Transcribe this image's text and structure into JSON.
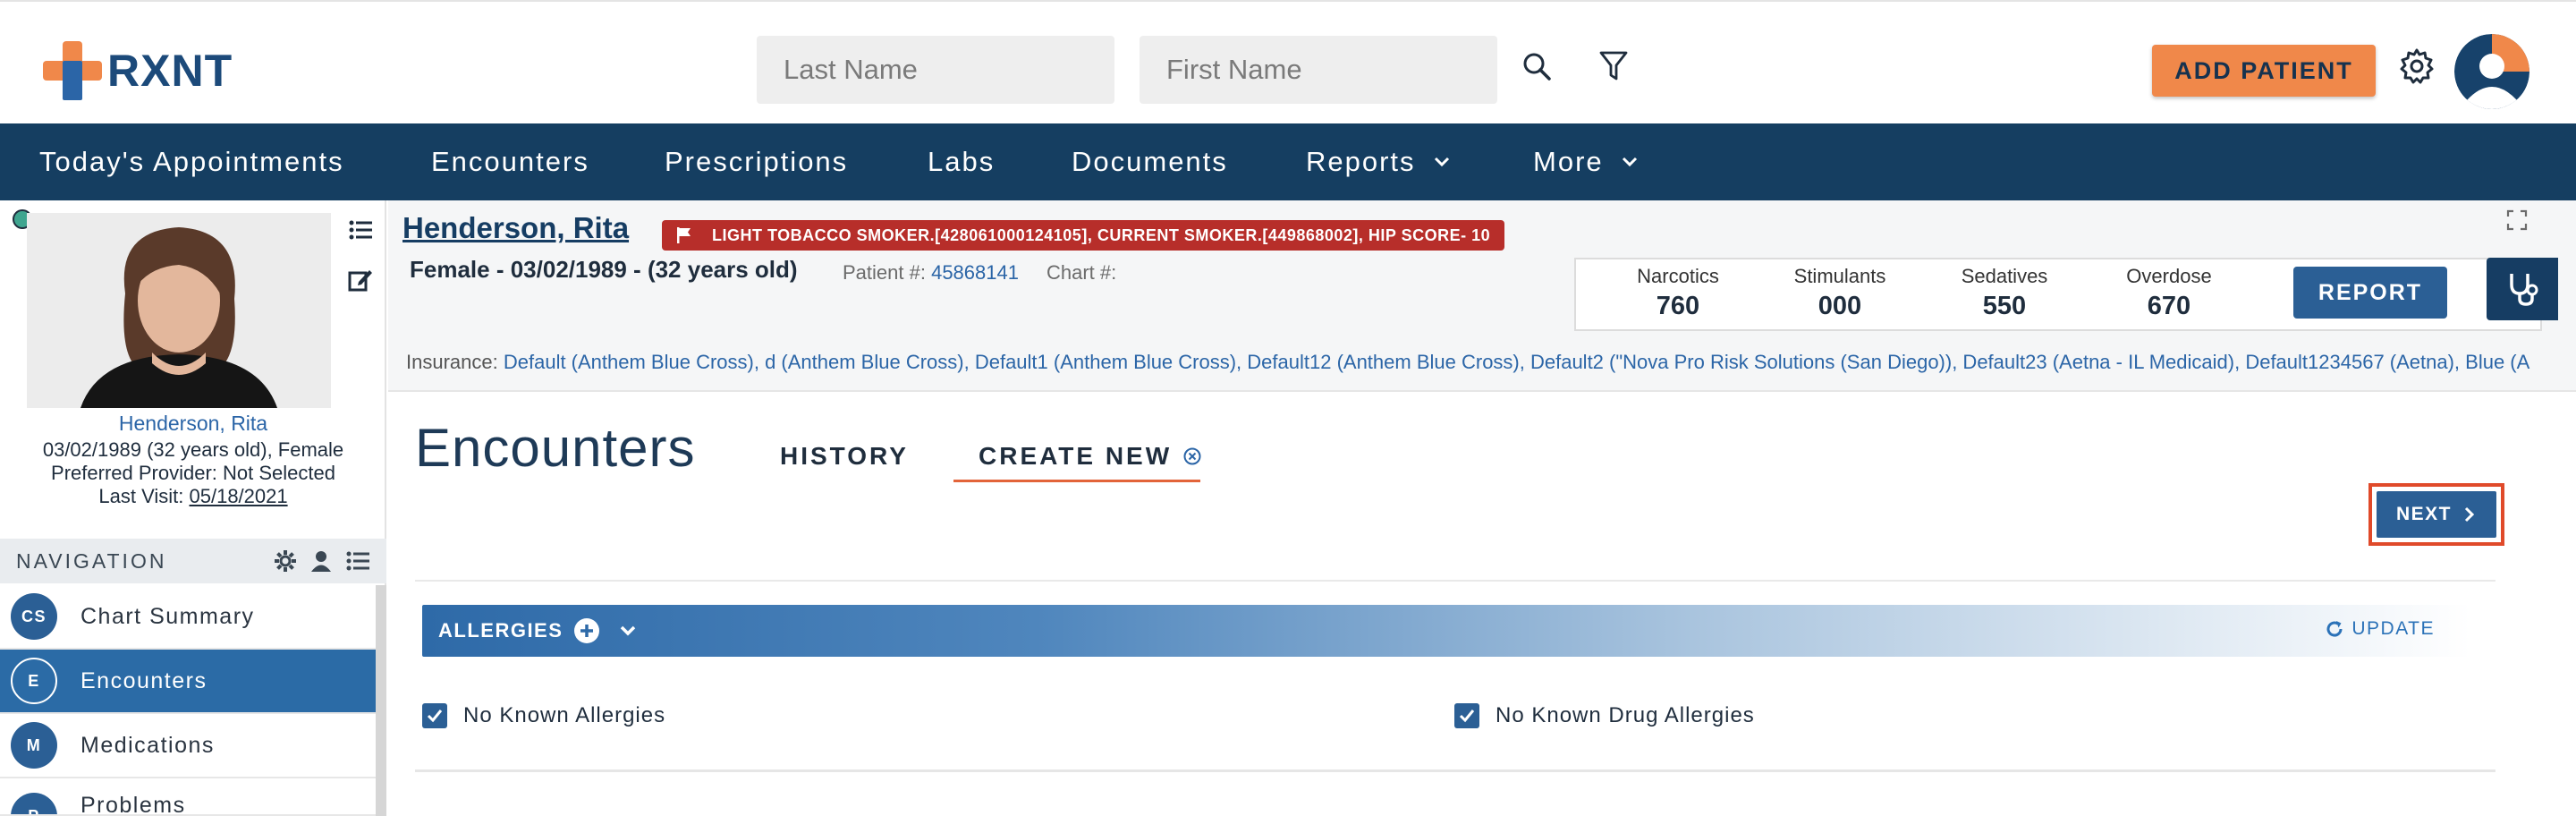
{
  "header": {
    "logo_text": "RXNT",
    "last_name_placeholder": "Last Name",
    "first_name_placeholder": "First Name",
    "add_patient_label": "ADD PATIENT"
  },
  "navbar": {
    "items": [
      {
        "label": "Today's Appointments"
      },
      {
        "label": "Encounters"
      },
      {
        "label": "Prescriptions"
      },
      {
        "label": "Labs"
      },
      {
        "label": "Documents"
      },
      {
        "label": "Reports"
      },
      {
        "label": "More"
      }
    ]
  },
  "left_panel": {
    "patient_name": "Henderson, Rita",
    "dob_gender": "03/02/1989 (32 years old), Female",
    "preferred_provider": "Preferred Provider: Not Selected",
    "last_visit_label": "Last Visit:",
    "last_visit_date": "05/18/2021",
    "navigation_title": "NAVIGATION",
    "nav_items": [
      {
        "badge": "CS",
        "label": "Chart Summary"
      },
      {
        "badge": "E",
        "label": "Encounters"
      },
      {
        "badge": "M",
        "label": "Medications"
      },
      {
        "badge": "P",
        "label": "Problems"
      }
    ]
  },
  "banner": {
    "patient_name": "Henderson, Rita",
    "alert_text": "LIGHT TOBACCO SMOKER.[428061000124105], CURRENT SMOKER.[449868002], HIP SCORE- 10",
    "demographics": "Female - 03/02/1989 - (32 years old)",
    "patient_number_label": "Patient #:",
    "patient_number": "45868141",
    "chart_number_label": "Chart #:",
    "pdmp": [
      {
        "label": "Narcotics",
        "value": "760"
      },
      {
        "label": "Stimulants",
        "value": "000"
      },
      {
        "label": "Sedatives",
        "value": "550"
      },
      {
        "label": "Overdose",
        "value": "670"
      }
    ],
    "report_label": "REPORT",
    "insurance_label": "Insurance:",
    "insurance_values": "Default (Anthem Blue Cross), d (Anthem Blue Cross), Default1 (Anthem Blue Cross), Default12 (Anthem Blue Cross), Default2 (\"Nova Pro Risk Solutions (San Diego)), Default23 (Aetna - IL Medicaid), Default1234567 (Aetna), Blue (A"
  },
  "main": {
    "title": "Encounters",
    "tabs": [
      {
        "label": "HISTORY"
      },
      {
        "label": "CREATE NEW"
      }
    ],
    "next_label": "NEXT",
    "allergies_label": "ALLERGIES",
    "update_label": "UPDATE",
    "checks": [
      {
        "label": "No Known Allergies",
        "checked": true
      },
      {
        "label": "No Known Drug Allergies",
        "checked": true
      }
    ]
  },
  "colors": {
    "navbar": "#153e61",
    "accent_orange": "#f0884a",
    "primary_blue": "#2b5f95",
    "alert_red": "#b72e2a"
  }
}
